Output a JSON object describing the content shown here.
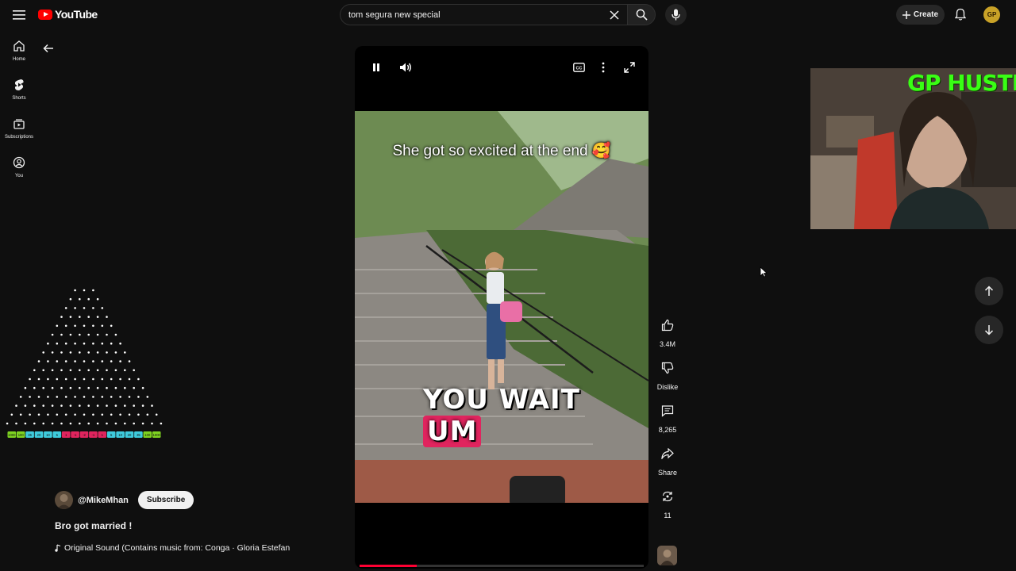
{
  "header": {
    "logo_text": "YouTube",
    "search_value": "tom segura new special",
    "create_label": "Create",
    "avatar_initials": "GP"
  },
  "sidebar": {
    "items": [
      {
        "label": "Home",
        "icon": "home-icon"
      },
      {
        "label": "Shorts",
        "icon": "shorts-icon"
      },
      {
        "label": "Subscriptions",
        "icon": "subscriptions-icon"
      },
      {
        "label": "You",
        "icon": "you-icon"
      }
    ]
  },
  "plinko": {
    "multipliers": [
      "1000",
      "100",
      "35",
      "20",
      "10",
      "5",
      "1",
      "-1",
      "-2",
      "-1",
      "1",
      "5",
      "10",
      "20",
      "35",
      "100",
      "1000"
    ],
    "colors": {
      "edge": "#7ed321",
      "mid": "#3ecbdc",
      "center": "#e0245e"
    }
  },
  "short": {
    "channel": "@MikeMhan",
    "subscribe_label": "Subscribe",
    "title": "Bro got married !",
    "music": "Original Sound (Contains music from: Conga · Gloria Estefan",
    "caption_top": "She got so excited at the end 🥰",
    "caption_big_1": "YOU WAIT",
    "caption_big_2": "UM",
    "progress": 0.2
  },
  "actions": {
    "like_count": "3.4M",
    "dislike_label": "Dislike",
    "comments_count": "8,265",
    "share_label": "Share",
    "remix_count": "11"
  },
  "webcam": {
    "overlay_text": "GP HUSTLA"
  },
  "colors": {
    "background": "#0f0f0f",
    "accent_red": "#ff0000",
    "webcam_text": "#39ff14"
  }
}
